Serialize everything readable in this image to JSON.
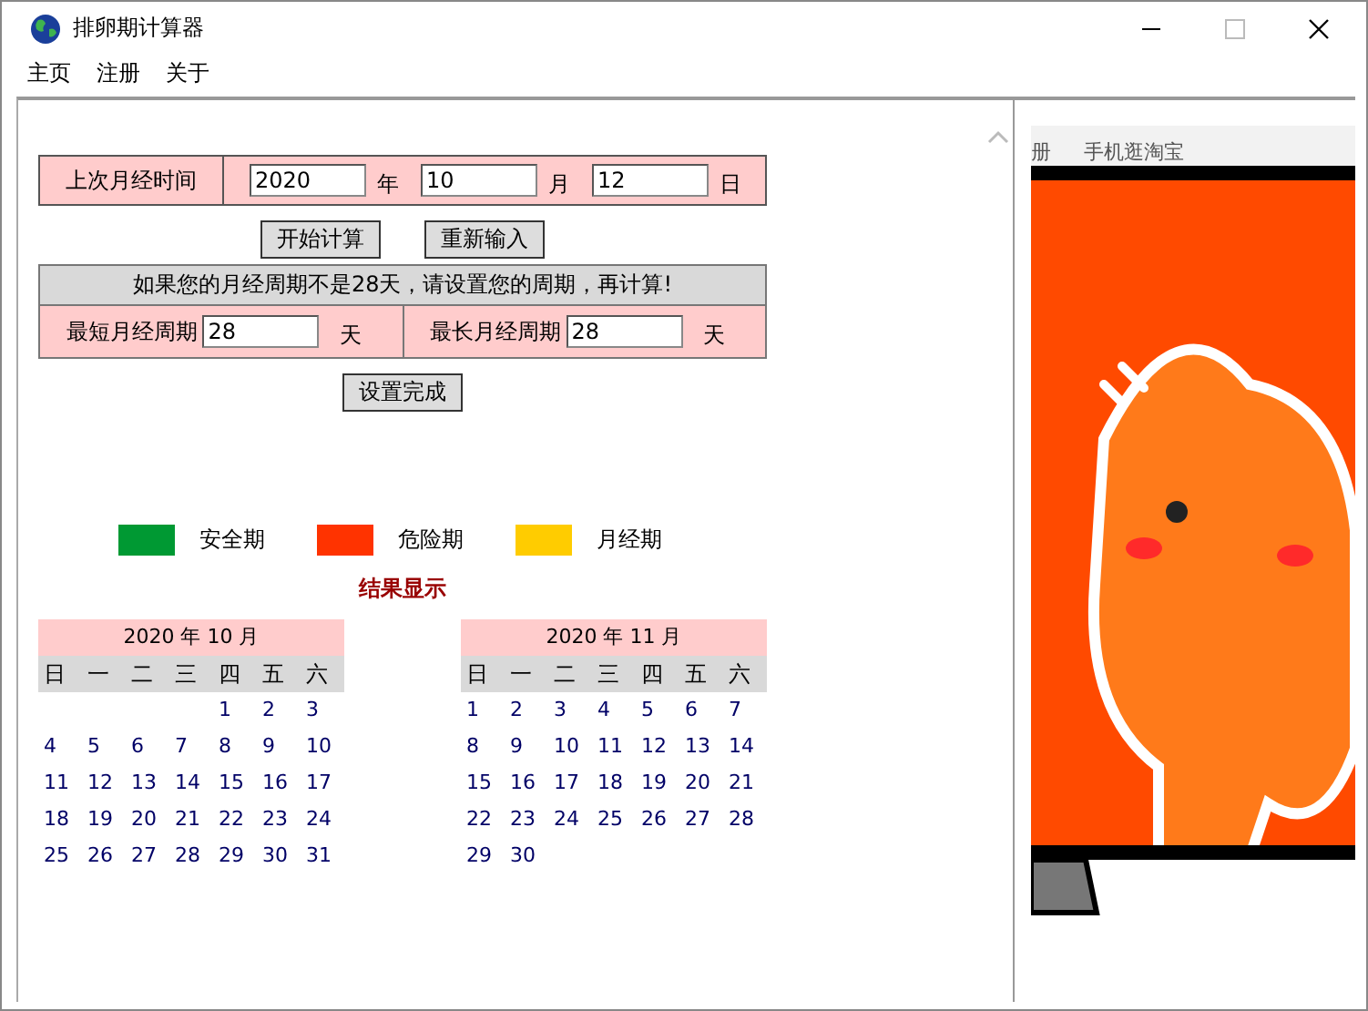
{
  "window": {
    "title": "排卵期计算器"
  },
  "menu": [
    "主页",
    "注册",
    "关于"
  ],
  "last_period": {
    "label": "上次月经时间",
    "fields": [
      {
        "value": "2020",
        "unit": "年"
      },
      {
        "value": "10",
        "unit": "月"
      },
      {
        "value": "12",
        "unit": "日"
      }
    ]
  },
  "buttons": [
    "开始计算",
    "重新输入"
  ],
  "cycle": {
    "notice": "如果您的月经周期不是28天，请设置您的周期，再计算!",
    "fields": [
      {
        "label": "最短月经周期",
        "value": "28",
        "unit": "天"
      },
      {
        "label": "最长月经周期",
        "value": "28",
        "unit": "天"
      }
    ],
    "button": "设置完成"
  },
  "legend": [
    {
      "label": "安全期",
      "color": "#009933"
    },
    {
      "label": "危险期",
      "color": "#ff3300"
    },
    {
      "label": "月经期",
      "color": "#ffcc00"
    }
  ],
  "result_title": "结果显示",
  "calendars": [
    {
      "title": "2020 年 10 月",
      "weekdays": [
        "日",
        "一",
        "二",
        "三",
        "四",
        "五",
        "六"
      ],
      "weeks": [
        [
          "1",
          "2",
          "3"
        ],
        [
          "4",
          "5",
          "6",
          "7",
          "8",
          "9",
          "10"
        ],
        [
          "11",
          "12",
          "13",
          "14",
          "15",
          "16",
          "17"
        ],
        [
          "18",
          "19",
          "20",
          "21",
          "22",
          "23",
          "24"
        ],
        [
          "25",
          "26",
          "27",
          "28",
          "29",
          "30",
          "31"
        ]
      ]
    },
    {
      "title": "2020 年 11 月",
      "weekdays": [
        "日",
        "一",
        "二",
        "三",
        "四",
        "五",
        "六"
      ],
      "weeks": [
        [
          "1",
          "2",
          "3",
          "4",
          "5",
          "6",
          "7"
        ],
        [
          "8",
          "9",
          "10",
          "11",
          "12",
          "13",
          "14"
        ],
        [
          "15",
          "16",
          "17",
          "18",
          "19",
          "20",
          "21"
        ],
        [
          "22",
          "23",
          "24",
          "25",
          "26",
          "27",
          "28"
        ],
        [
          "29",
          "30"
        ]
      ]
    }
  ],
  "side_panel": {
    "nav": [
      "册",
      "手机逛淘宝"
    ]
  }
}
